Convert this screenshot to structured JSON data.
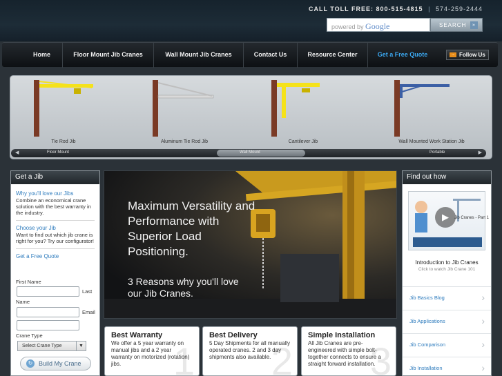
{
  "header": {
    "toll_label": "CALL TOLL FREE:",
    "toll_number": "800-515-4815",
    "separator": "|",
    "alt_number": "574-259-2444",
    "search_powered": "powered by",
    "search_brand": "Google",
    "search_button": "SEARCH",
    "search_arrow": "»"
  },
  "nav": {
    "items": [
      {
        "label": "Home"
      },
      {
        "label": "Floor Mount Jib Cranes"
      },
      {
        "label": "Wall Mount Jib Cranes"
      },
      {
        "label": "Contact Us"
      },
      {
        "label": "Resource Center"
      },
      {
        "label": "Get a Free Quote"
      }
    ],
    "follow_label": "Follow Us",
    "follow_icon": "→"
  },
  "carousel": {
    "cranes": [
      {
        "label": "Tie Rod Jib"
      },
      {
        "label": "Aluminum Tie Rod Jib"
      },
      {
        "label": "Cantilever Jib"
      },
      {
        "label": "Wall Mounted Work Station Jib"
      }
    ],
    "slider": {
      "left_arrow": "◀",
      "right_arrow": "▶",
      "labels": [
        "Floor Mount",
        "Wall Mount",
        "Portable"
      ]
    },
    "colors": {
      "crane_yellow": "#f5e21a",
      "column": "#7a3a25",
      "wall_beam": "#3b5fa5"
    }
  },
  "left_panel": {
    "title": "Get a Jib",
    "why_link": "Why you'll love our Jibs",
    "why_text": "Combine an economical crane solution with the best warranty in the industry.",
    "choose_link": "Choose your Jib",
    "choose_text": "Want to find out which jib crane is right for you? Try our configurator!",
    "quote_link": "Get a Free Quote",
    "first_name": "First Name",
    "last_name": "Last",
    "name_word": "Name",
    "email": "Email",
    "crane_type": "Crane Type",
    "select_value": "Select Crane Type",
    "select_caret": "▼",
    "build_button": "Build My Crane",
    "build_icon": "↻"
  },
  "hero": {
    "headline": "Maximum Versatility and Performance with Superior Load Positioning.",
    "subline": "3 Reasons why you'll love our Jib Cranes."
  },
  "features": [
    {
      "title": "Best Warranty",
      "text": "We offer a 5 year warranty on manual jibs and a 2 year warranty on motorized (rotation) jibs.",
      "num": "1"
    },
    {
      "title": "Best Delivery",
      "text": "5 Day Shipments for all manually operated cranes. 2 and 3 day shipments also available.",
      "num": "2"
    },
    {
      "title": "Simple Installation",
      "text": "All Jib Cranes are pre-engineered with simple bolt-together connects to ensure a straight forward installation.",
      "num": "3"
    }
  ],
  "right_panel": {
    "title": "Find out how",
    "video_title": "Jib Cranes - Part 1",
    "video_play": "▶",
    "video_caption": "Introduction to Jib Cranes",
    "video_sub": "Click to watch Jib Crane 101",
    "links": [
      {
        "label": "Jib Basics Blog"
      },
      {
        "label": "Jib Applications"
      },
      {
        "label": "Jib Comparison"
      },
      {
        "label": "Jib Installation"
      }
    ],
    "chevron": "›"
  }
}
